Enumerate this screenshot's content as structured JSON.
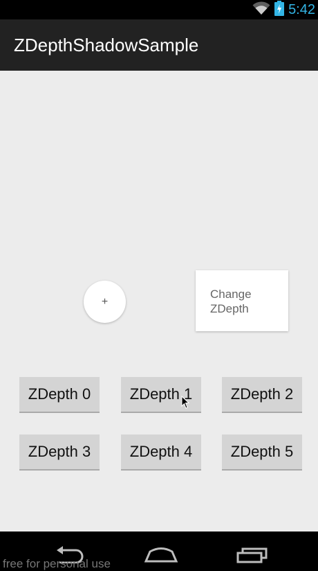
{
  "status_bar": {
    "time": "5:42",
    "icons": [
      "wifi-icon",
      "battery-charging-icon"
    ]
  },
  "app": {
    "title": "ZDepthShadowSample"
  },
  "circle_button": {
    "label": "+"
  },
  "card": {
    "label": "Change ZDepth"
  },
  "buttons": [
    {
      "label": "ZDepth 0"
    },
    {
      "label": "ZDepth 1"
    },
    {
      "label": "ZDepth 2"
    },
    {
      "label": "ZDepth 3"
    },
    {
      "label": "ZDepth 4"
    },
    {
      "label": "ZDepth 5"
    }
  ],
  "nav_bar": {
    "watermark": "free for personal use",
    "icons": [
      "back-icon",
      "home-icon",
      "recents-icon"
    ]
  },
  "colors": {
    "status_time": "#33b5e5",
    "action_bar": "#222222",
    "background": "#ececec",
    "button": "#d4d4d4"
  }
}
